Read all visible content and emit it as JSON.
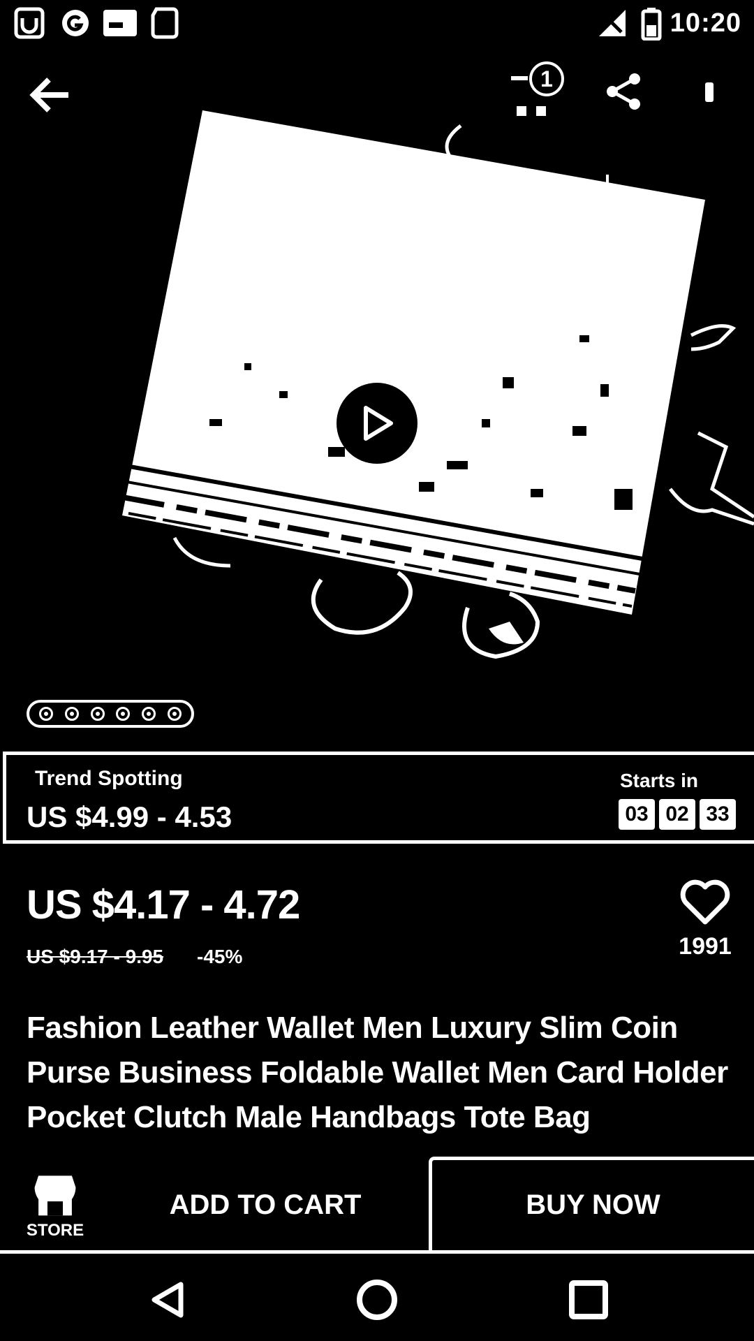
{
  "status_bar": {
    "time": "10:20",
    "icons": [
      "app-notification-icon",
      "g-icon",
      "card-icon",
      "sd-card-icon",
      "no-signal-icon",
      "battery-icon"
    ]
  },
  "toolbar": {
    "icons": [
      "back-arrow-icon",
      "cart-icon",
      "share-icon",
      "more-vert-icon"
    ],
    "cart_count": "1"
  },
  "media": {
    "image_desc_icon": "wallet-photo",
    "play_icon": "play-icon",
    "page_count": 6
  },
  "promo": {
    "title": "Trend Spotting",
    "price": "US $4.99 - 4.53",
    "starts_label": "Starts in",
    "countdown": [
      "03",
      "02",
      "33"
    ]
  },
  "product": {
    "price": "US $4.17 - 4.72",
    "original_price": "US $9.17 - 9.95",
    "discount": "-45%",
    "wishlist_count": "1991",
    "title": "Fashion Leather Wallet Men Luxury Slim Coin Purse Business Foldable Wallet Men Card Holder Pocket Clutch Male Handbags Tote Bag"
  },
  "actions": {
    "store_label": "STORE",
    "add_to_cart": "ADD TO CART",
    "buy_now": "BUY NOW"
  },
  "nav": {
    "icons": [
      "nav-back-icon",
      "nav-home-icon",
      "nav-recents-icon"
    ]
  },
  "colors": {
    "background": "#000000",
    "foreground": "#ffffff"
  }
}
